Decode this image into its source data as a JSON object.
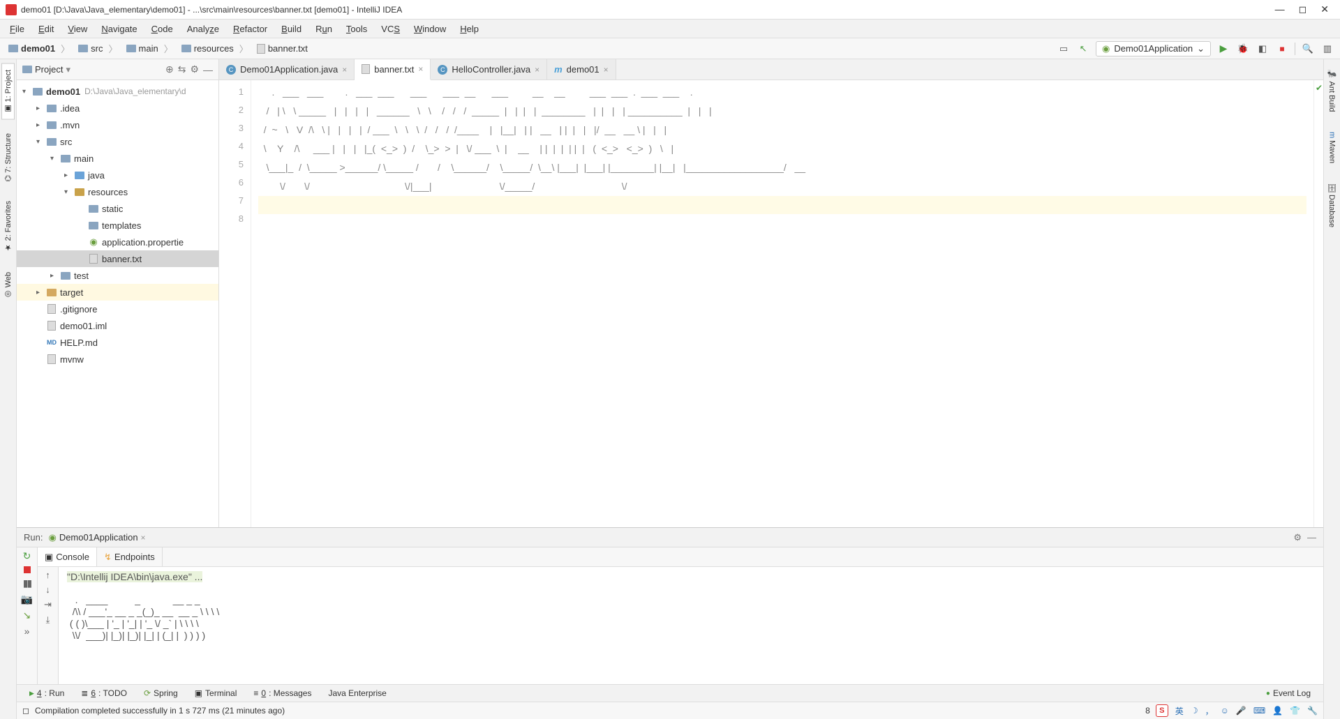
{
  "window": {
    "title": "demo01 [D:\\Java\\Java_elementary\\demo01] - ...\\src\\main\\resources\\banner.txt [demo01] - IntelliJ IDEA"
  },
  "menu": {
    "items": [
      "File",
      "Edit",
      "View",
      "Navigate",
      "Code",
      "Analyze",
      "Refactor",
      "Build",
      "Run",
      "Tools",
      "VCS",
      "Window",
      "Help"
    ]
  },
  "breadcrumbs": [
    "demo01",
    "src",
    "main",
    "resources",
    "banner.txt"
  ],
  "runConfig": {
    "name": "Demo01Application"
  },
  "projectPanel": {
    "title": "Project",
    "root": {
      "name": "demo01",
      "path": "D:\\Java\\Java_elementary\\d"
    },
    "nodes": {
      "idea": ".idea",
      "mvn": ".mvn",
      "src": "src",
      "main": "main",
      "java": "java",
      "resources": "resources",
      "static": "static",
      "templates": "templates",
      "appProps": "application.propertie",
      "banner": "banner.txt",
      "test": "test",
      "target": "target",
      "gitignore": ".gitignore",
      "iml": "demo01.iml",
      "help": "HELP.md",
      "mvnw": "mvnw"
    }
  },
  "editorTabs": [
    {
      "label": "Demo01Application.java",
      "type": "class"
    },
    {
      "label": "banner.txt",
      "type": "file"
    },
    {
      "label": "HelloController.java",
      "type": "class"
    },
    {
      "label": "demo01",
      "type": "module"
    }
  ],
  "editor": {
    "lines": [
      "1",
      "2",
      "3",
      "4",
      "5",
      "6",
      "7",
      "8"
    ],
    "content": "     .   ___   ___        .   ___  ___      ___      ___  __      ___         __    __         ___  ___  .  ___  ___    .    \n   /   | \\   \\ _____   |   |   |   |   ______   \\   \\    /   /   /  _____  |   |  |   |  ________   |  |   |   | __________  |   |   |\n  /  ~   \\   V  /\\   \\ |   |   |   |  / ___  \\   \\   \\  /   /   /  /____    |   |__|   | |   __   | |  |   |   |/  __   __ \\ |   |   |\n  \\    Y    /\\     ___ |   |   |   |_(  <_>  )  /    \\_>  >  |   \\/ ___  \\  |    __    | |  |  |  | |  |   (  <_>   <_>  )   \\   |\n   \\___|_  /  \\_____ >______/ \\_____ /       /    \\______/    \\_____/  \\__\\ |___|  |___| |________| |__|   |__________________/   __\n        \\/       \\/                                   \\/|___|                         \\/_____/                                \\/",
    "cursorLine": "    "
  },
  "runPanel": {
    "label": "Run:",
    "config": "Demo01Application",
    "tabs": {
      "console": "Console",
      "endpoints": "Endpoints"
    },
    "consoleCmd": "\"D:\\Intellij IDEA\\bin\\java.exe\" ...",
    "art": "   .   ____          _            __ _ _\n  /\\\\ / ___'_ __ _ _(_)_ __  __ _ \\ \\ \\ \\\n ( ( )\\___ | '_ | '_| | '_ \\/ _` | \\ \\ \\ \\\n  \\\\/  ___)| |_)| |_)| |_| | (_| |  ) ) ) )"
  },
  "bottomTabs": {
    "run": "4: Run",
    "todo": "6: TODO",
    "spring": "Spring",
    "terminal": "Terminal",
    "messages": "0: Messages",
    "javaee": "Java Enterprise",
    "eventLog": "Event Log"
  },
  "rightTabs": {
    "ant": "Ant Build",
    "maven": "Maven",
    "database": "Database"
  },
  "leftTabs": {
    "project": "1: Project",
    "structure": "7: Structure",
    "favorites": "2: Favorites",
    "web": "Web"
  },
  "status": {
    "message": "Compilation completed successfully in 1 s 727 ms (21 minutes ago)",
    "col": "8",
    "ime": "英"
  }
}
